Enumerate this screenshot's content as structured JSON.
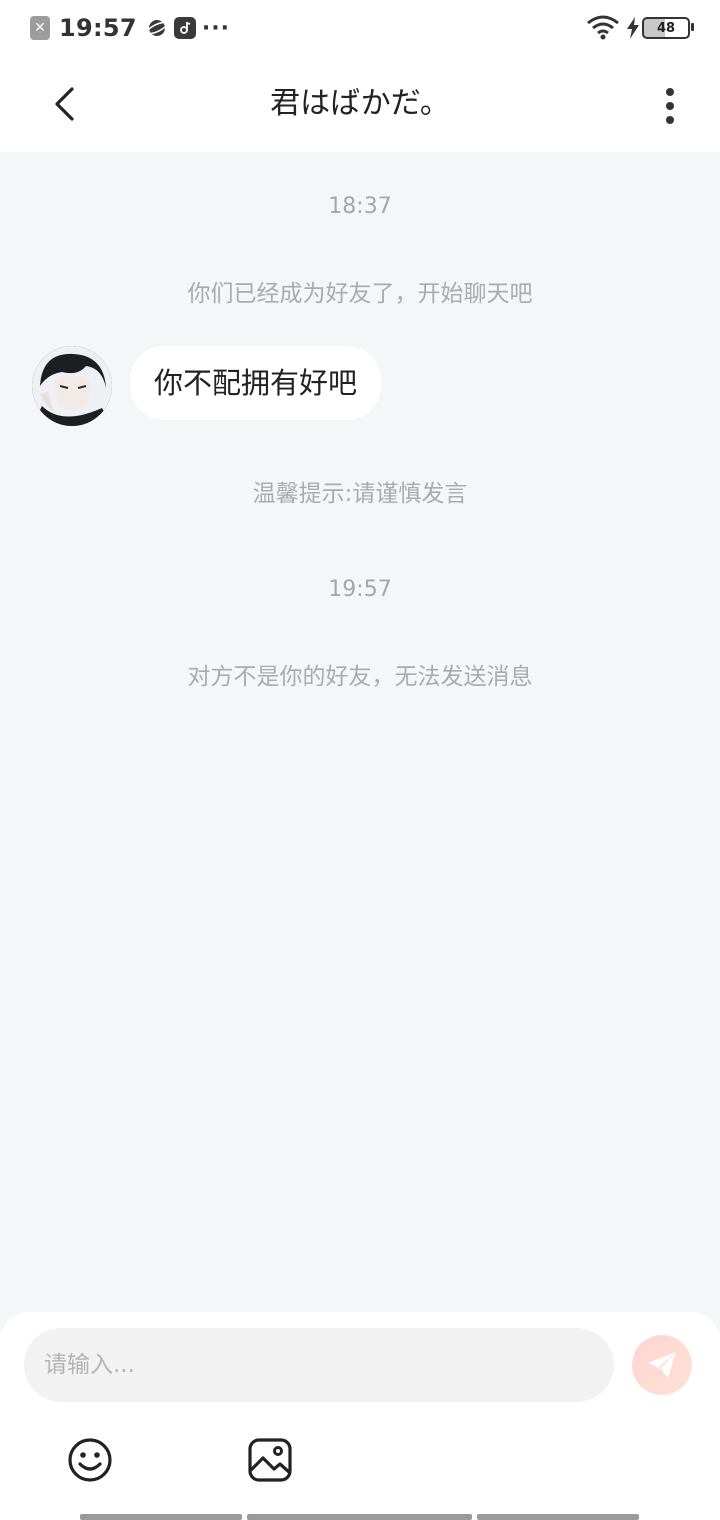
{
  "status_bar": {
    "time": "19:57",
    "more_indicator": "···",
    "battery_level": "48",
    "icons": [
      "app-notification-icon",
      "planet-icon",
      "music-icon",
      "wifi-icon",
      "charging-bolt-icon",
      "battery-icon"
    ]
  },
  "header": {
    "title": "君はばかだ。",
    "back_icon": "chevron-left-icon",
    "more_icon": "more-vertical-icon"
  },
  "chat": {
    "time_1": "18:37",
    "system_1": "你们已经成为好友了，开始聊天吧",
    "message_1": "你不配拥有好吧",
    "tip": "温馨提示:请谨慎发言",
    "time_2": "19:57",
    "system_2": "对方不是你的好友，无法发送消息"
  },
  "input_bar": {
    "placeholder": "请输入...",
    "value": "",
    "send_icon": "paper-plane-icon",
    "emoji_icon": "smile-icon",
    "image_icon": "image-icon"
  },
  "colors": {
    "background": "#f5f6f8",
    "secondary_text": "#a8abb1",
    "send_button": "#ffd3d2"
  }
}
